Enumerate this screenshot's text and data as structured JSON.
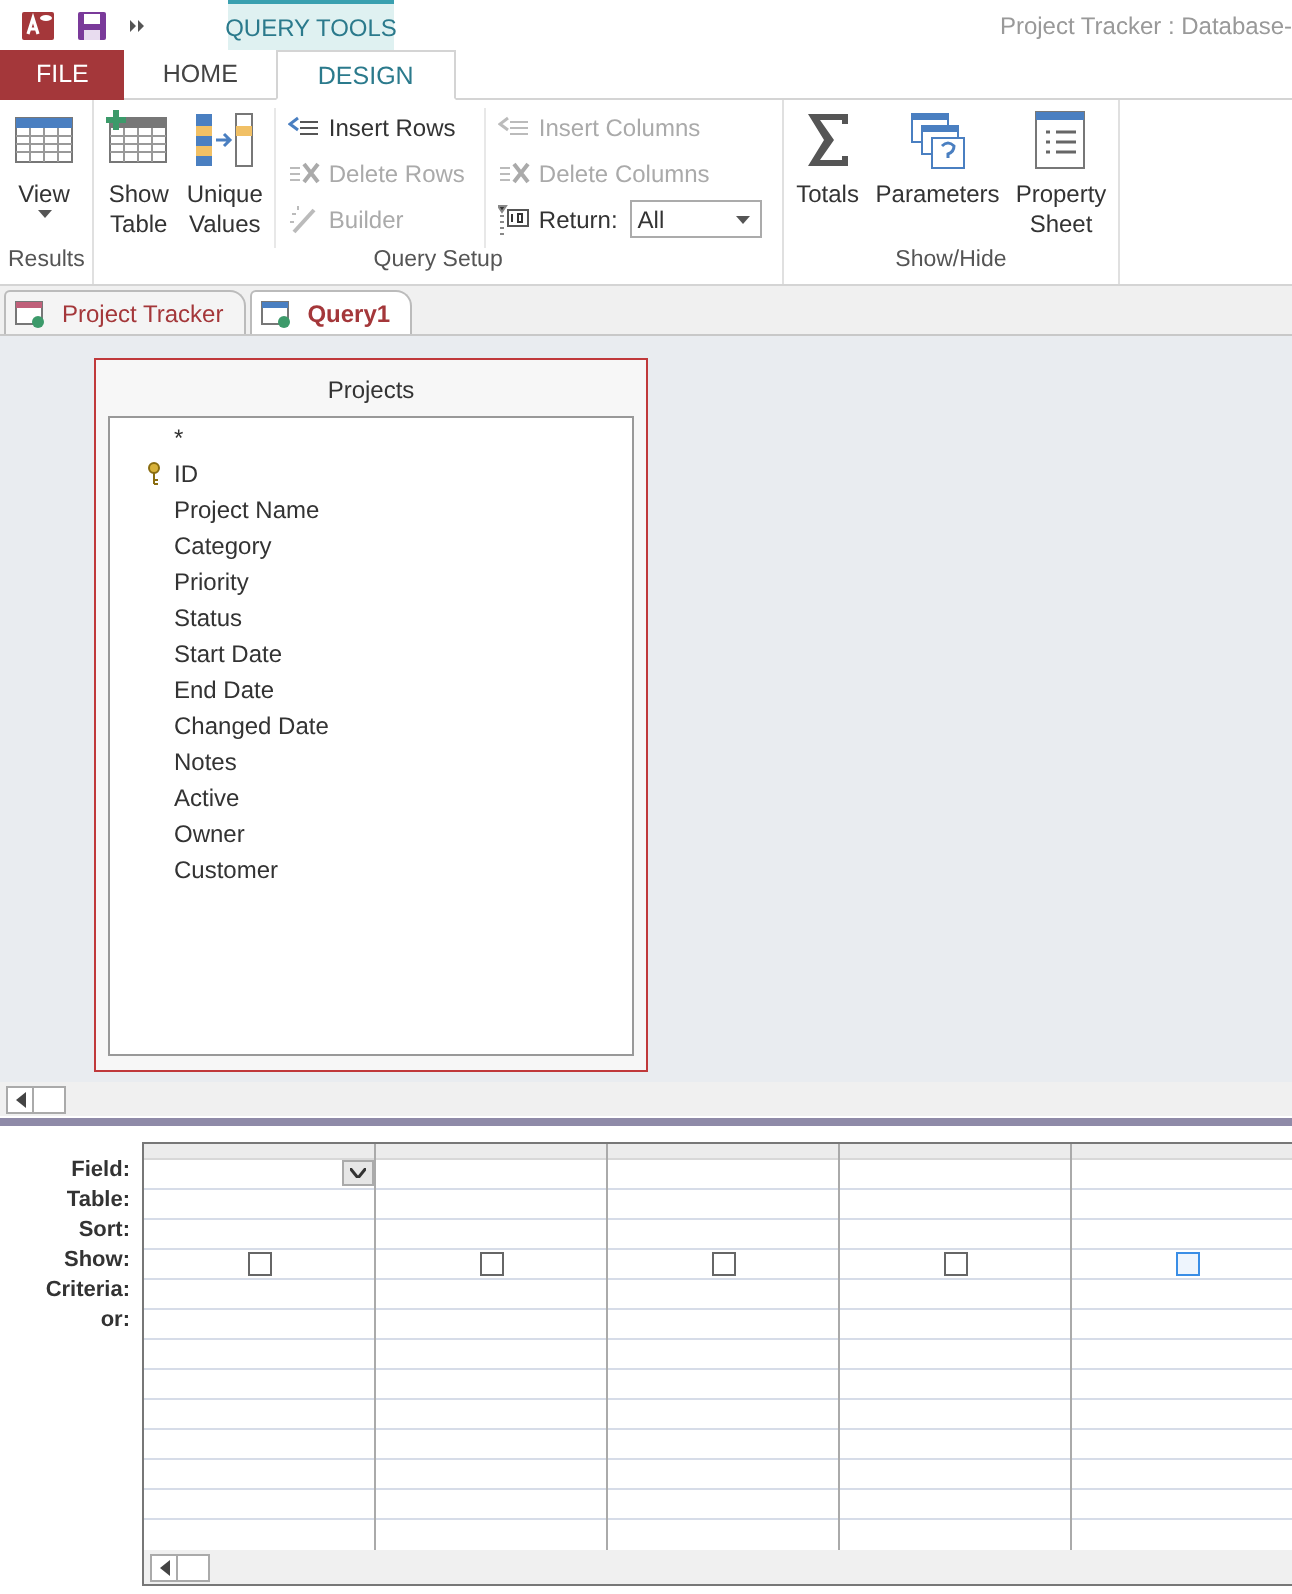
{
  "window": {
    "title": "Project Tracker : Database-"
  },
  "context_tab": {
    "label": "QUERY TOOLS"
  },
  "tabs": [
    {
      "label": "FILE",
      "kind": "file",
      "selected": false
    },
    {
      "label": "HOME",
      "kind": "tab",
      "selected": false
    },
    {
      "label": "DESIGN",
      "kind": "tab",
      "selected": true
    }
  ],
  "ribbon": {
    "groups": [
      {
        "label": "Results",
        "columns": [
          {
            "kind": "large",
            "label": "View",
            "dropdown": true
          }
        ]
      },
      {
        "label": "Query Setup",
        "columns": [
          {
            "kind": "large",
            "label": "Show Table",
            "dropdown": false
          },
          {
            "kind": "large",
            "label": "Unique Values",
            "dropdown": false
          },
          {
            "kind": "stack",
            "items": [
              {
                "kind": "button",
                "label": "Insert Rows",
                "disabled": false
              },
              {
                "kind": "button",
                "label": "Delete Rows",
                "disabled": true
              },
              {
                "kind": "button",
                "label": "Builder",
                "disabled": true
              }
            ]
          },
          {
            "kind": "stack",
            "items": [
              {
                "kind": "button",
                "label": "Insert Columns",
                "disabled": true
              },
              {
                "kind": "button",
                "label": "Delete Columns",
                "disabled": true
              },
              {
                "kind": "select",
                "label": "Return:",
                "value": "All",
                "disabled": false
              }
            ]
          }
        ]
      },
      {
        "label": "Show/Hide",
        "columns": [
          {
            "kind": "large",
            "label": "Totals",
            "dropdown": false
          },
          {
            "kind": "large",
            "label": "Parameters",
            "dropdown": false
          },
          {
            "kind": "large",
            "label": "Property Sheet",
            "dropdown": false
          }
        ]
      }
    ]
  },
  "documents": [
    {
      "label": "Project Tracker",
      "selected": false
    },
    {
      "label": "Query1",
      "selected": true
    }
  ],
  "table_box": {
    "title": "Projects",
    "fields": [
      {
        "label": "*",
        "primary_key": false
      },
      {
        "label": "ID",
        "primary_key": true
      },
      {
        "label": "Project Name",
        "primary_key": false
      },
      {
        "label": "Category",
        "primary_key": false
      },
      {
        "label": "Priority",
        "primary_key": false
      },
      {
        "label": "Status",
        "primary_key": false
      },
      {
        "label": "Start Date",
        "primary_key": false
      },
      {
        "label": "End Date",
        "primary_key": false
      },
      {
        "label": "Changed Date",
        "primary_key": false
      },
      {
        "label": "Notes",
        "primary_key": false
      },
      {
        "label": "Active",
        "primary_key": false
      },
      {
        "label": "Owner",
        "primary_key": false
      },
      {
        "label": "Customer",
        "primary_key": false
      }
    ]
  },
  "design_grid": {
    "row_labels": [
      "Field:",
      "Table:",
      "Sort:",
      "Show:",
      "Criteria:",
      "or:"
    ],
    "columns": [
      {
        "show_checked": false,
        "show_highlighted": false,
        "field_dropdown": true
      },
      {
        "show_checked": false,
        "show_highlighted": false,
        "field_dropdown": false
      },
      {
        "show_checked": false,
        "show_highlighted": false,
        "field_dropdown": false
      },
      {
        "show_checked": false,
        "show_highlighted": false,
        "field_dropdown": false
      },
      {
        "show_checked": false,
        "show_highlighted": true,
        "field_dropdown": false
      }
    ]
  }
}
